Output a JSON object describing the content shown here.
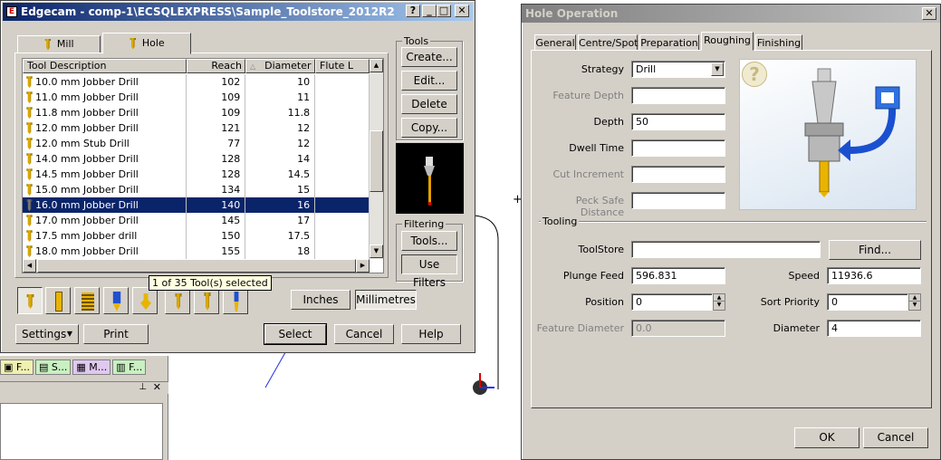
{
  "toolstore": {
    "title": "Edgecam - comp-1\\ECSQLEXPRESS\\Sample_Toolstore_2012R2",
    "tabs": [
      {
        "label": "Mill"
      },
      {
        "label": "Hole"
      }
    ],
    "columns": {
      "desc": "Tool Description",
      "reach": "Reach",
      "diameter": "Diameter",
      "flute": "Flute L"
    },
    "rows": [
      {
        "desc": "10.0 mm Jobber Drill",
        "reach": "102",
        "diameter": "10"
      },
      {
        "desc": "11.0 mm Jobber Drill",
        "reach": "109",
        "diameter": "11"
      },
      {
        "desc": "11.8 mm Jobber Drill",
        "reach": "109",
        "diameter": "11.8"
      },
      {
        "desc": "12.0 mm Jobber Drill",
        "reach": "121",
        "diameter": "12"
      },
      {
        "desc": "12.0 mm Stub Drill",
        "reach": "77",
        "diameter": "12"
      },
      {
        "desc": "14.0 mm Jobber Drill",
        "reach": "128",
        "diameter": "14"
      },
      {
        "desc": "14.5 mm Jobber Drill",
        "reach": "128",
        "diameter": "14.5"
      },
      {
        "desc": "15.0 mm Jobber Drill",
        "reach": "134",
        "diameter": "15"
      },
      {
        "desc": "16.0 mm Jobber Drill",
        "reach": "140",
        "diameter": "16"
      },
      {
        "desc": "17.0 mm Jobber Drill",
        "reach": "145",
        "diameter": "17"
      },
      {
        "desc": "17.5 mm Jobber drill",
        "reach": "150",
        "diameter": "17.5"
      },
      {
        "desc": "18.0 mm Jobber Drill",
        "reach": "155",
        "diameter": "18"
      }
    ],
    "selected_index": 8,
    "tools_group": "Tools",
    "buttons": {
      "create": "Create...",
      "edit": "Edit...",
      "delete": "Delete",
      "copy": "Copy...",
      "filter_tools": "Tools...",
      "use_filters": "Use Filters",
      "inches": "Inches",
      "millimetres": "Millimetres",
      "settings": "Settings",
      "print": "Print",
      "select": "Select",
      "cancel": "Cancel",
      "help": "Help"
    },
    "filtering_group": "Filtering",
    "status_tooltip": "1 of 35 Tool(s) selected"
  },
  "taskbar": {
    "tabs": [
      {
        "label": "F..."
      },
      {
        "label": "S..."
      },
      {
        "label": "M..."
      },
      {
        "label": "F..."
      }
    ]
  },
  "hole": {
    "title": "Hole Operation",
    "tabs": [
      {
        "label": "General"
      },
      {
        "label": "Centre/Spot"
      },
      {
        "label": "Preparation"
      },
      {
        "label": "Roughing"
      },
      {
        "label": "Finishing"
      }
    ],
    "active_tab": "Roughing",
    "fields": {
      "strategy": {
        "label": "Strategy",
        "value": "Drill"
      },
      "feature_depth": {
        "label": "Feature Depth",
        "value": ""
      },
      "depth": {
        "label": "Depth",
        "value": "50"
      },
      "dwell_time": {
        "label": "Dwell Time",
        "value": ""
      },
      "cut_increment": {
        "label": "Cut Increment",
        "value": ""
      },
      "peck_safe": {
        "label": "Peck Safe Distance",
        "value": ""
      }
    },
    "tooling_group": "Tooling",
    "tooling": {
      "toolstore": {
        "label": "ToolStore",
        "value": ""
      },
      "find": "Find...",
      "plunge_feed": {
        "label": "Plunge Feed",
        "value": "596.831"
      },
      "speed": {
        "label": "Speed",
        "value": "11936.6"
      },
      "position": {
        "label": "Position",
        "value": "0"
      },
      "sort_priority": {
        "label": "Sort Priority",
        "value": "0"
      },
      "feature_diameter": {
        "label": "Feature Diameter",
        "value": "0.0"
      },
      "diameter": {
        "label": "Diameter",
        "value": "4"
      }
    },
    "ok": "OK",
    "cancel": "Cancel"
  }
}
